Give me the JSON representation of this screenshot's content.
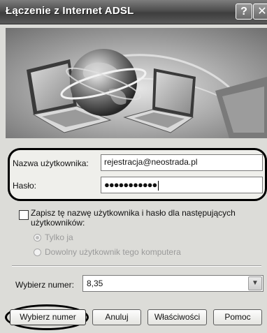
{
  "window": {
    "title": "Łączenie z Internet ADSL",
    "help_glyph": "?",
    "close_glyph": "✕"
  },
  "form": {
    "username_label": "Nazwa użytkownika:",
    "username_value": "rejestracja@neostrada.pl",
    "password_label": "Hasło:",
    "password_value": "●●●●●●●●●●●",
    "save_checkbox_checked": false,
    "save_label": "Zapisz tę nazwę użytkownika i hasło dla następujących użytkowników:",
    "radio_only_me_label": "Tylko ja",
    "radio_anyone_label": "Dowolny użytkownik tego komputera",
    "radio_only_me_selected": true
  },
  "dial": {
    "label": "Wybierz numer:",
    "value": "8,35",
    "arrow_icon": "chevron-down-icon"
  },
  "buttons": {
    "dial": "Wybierz numer",
    "cancel": "Anuluj",
    "properties": "Właściwości",
    "help": "Pomoc"
  }
}
